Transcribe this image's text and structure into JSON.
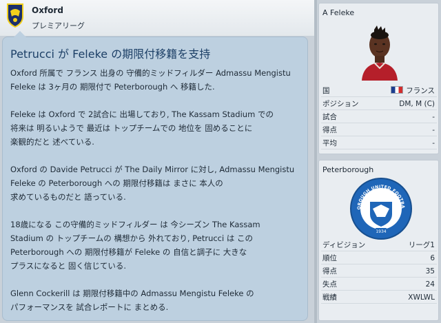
{
  "header": {
    "club": "Oxford",
    "league": "プレミアリーグ"
  },
  "news": {
    "title": "Petrucci が Feleke の期限付移籍を支持",
    "lines": [
      [
        "Oxford 所属で フランス 出身の 守備的ミッドフィルダー Admassu Mengistu",
        "Feleke は 3ヶ月の 期限付で Peterborough へ 移籍した."
      ],
      [
        "Feleke は Oxford で 2試合に 出場しており, The Kassam Stadium での",
        "将来は 明るいようで 最近は トップチームでの 地位を 固めることに",
        "楽観的だと 述べている."
      ],
      [
        "Oxford の Davide Petrucci が The Daily Mirror に対し, Admassu Mengistu",
        "Feleke の Peterborough への 期限付移籍は まさに 本人の",
        "求めているものだと 語っている."
      ],
      [
        "18歳になる この守備的ミッドフィルダー は 今シーズン The Kassam",
        "Stadium の トップチームの 構想から 外れており, Petrucci は この",
        "Peterborough への 期限付移籍が Feleke の 自信と調子に 大きな",
        "プラスになると 固く信じている."
      ],
      [
        "Glenn Cockerill は 期限付移籍中の Admassu Mengistu Feleke の",
        "パフォーマンスを 試合レポートに まとめる."
      ]
    ]
  },
  "player": {
    "name": "A Feleke",
    "stats": [
      {
        "label": "国",
        "value": "フランス"
      },
      {
        "label": "ポジション",
        "value": "DM, M (C)"
      },
      {
        "label": "試合",
        "value": "-"
      },
      {
        "label": "得点",
        "value": "-"
      },
      {
        "label": "平均",
        "value": "-"
      }
    ],
    "colors": {
      "flag": [
        "#1d3d8f",
        "#ffffff",
        "#d22d2d"
      ]
    }
  },
  "club": {
    "name": "Peterborough",
    "crest_text": "PETERBOROUGH UNITED FOOTBALL CLUB",
    "crest_year": "1934",
    "stats": [
      {
        "label": "ディビジョン",
        "value": "リーグ1"
      },
      {
        "label": "順位",
        "value": "6"
      },
      {
        "label": "得点",
        "value": "35"
      },
      {
        "label": "失点",
        "value": "24"
      },
      {
        "label": "戦績",
        "value": "XWLWL"
      }
    ]
  }
}
